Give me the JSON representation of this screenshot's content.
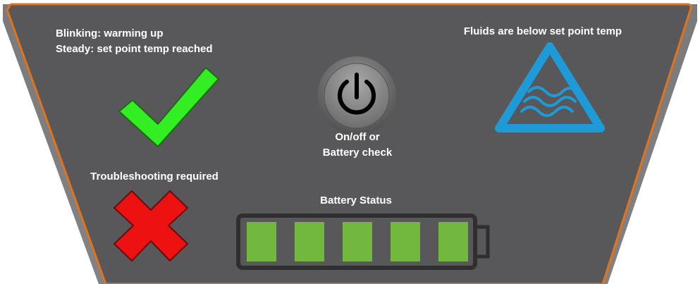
{
  "indicators": {
    "status_line1": "Blinking: warming up",
    "status_line2": "Steady: set point temp reached",
    "check_icon": "checkmark-icon",
    "check_color": "#33ee22",
    "troubleshooting": "Troubleshooting required",
    "x_icon": "x-icon",
    "x_color": "#ee1111"
  },
  "power": {
    "line1": "On/off or",
    "line2": "Battery check",
    "icon": "power-icon"
  },
  "fluids": {
    "label": "Fluids are below set point temp",
    "icon": "warning-fluid-icon",
    "color": "#1e9ad6"
  },
  "battery": {
    "label": "Battery Status",
    "cells_filled": 5,
    "cells_total": 5,
    "cell_color": "#73b83e"
  },
  "panel": {
    "background": "#58585a",
    "border_color": "#e0731c"
  }
}
